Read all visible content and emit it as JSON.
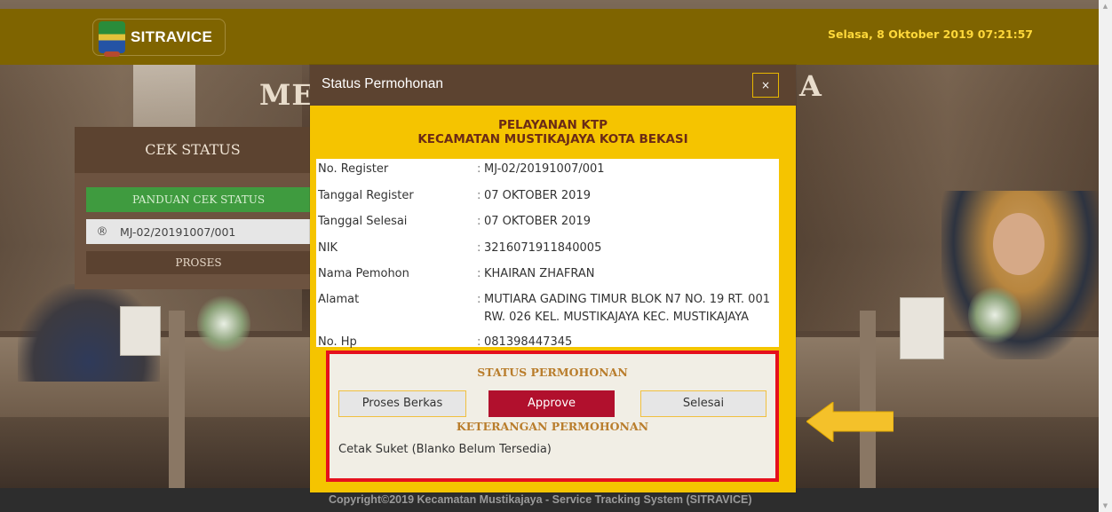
{
  "header": {
    "logo_text": "SITRAVICE",
    "datetime": "Selasa, 8 Oktober 2019 07:21:57"
  },
  "background": {
    "wall_text_left": "ME",
    "wall_text_right": "A"
  },
  "cek_status": {
    "title": "CEK STATUS",
    "panduan_label": "PANDUAN CEK STATUS",
    "input_icon": "registered-icon",
    "input_value": "MJ-02/20191007/001",
    "proses_label": "PROSES"
  },
  "modal": {
    "title": "Status Permohonan",
    "close_symbol": "×",
    "service_line1": "PELAYANAN KTP",
    "service_line2": "KECAMATAN MUSTIKAJAYA KOTA BEKASI",
    "fields": [
      {
        "label": "No. Register",
        "value": "MJ-02/20191007/001"
      },
      {
        "label": "Tanggal Register",
        "value": "07 OKTOBER 2019"
      },
      {
        "label": "Tanggal Selesai",
        "value": "07 OKTOBER 2019"
      },
      {
        "label": "NIK",
        "value": "3216071911840005"
      },
      {
        "label": "Nama Pemohon",
        "value": "KHAIRAN ZHAFRAN"
      },
      {
        "label": "Alamat",
        "value": "MUTIARA GADING TIMUR BLOK N7 NO. 19 RT. 001 RW. 026 KEL. MUSTIKAJAYA KEC. MUSTIKAJAYA"
      },
      {
        "label": "No. Hp",
        "value": "081398447345"
      }
    ],
    "status_heading": "STATUS PERMOHONAN",
    "status_buttons": [
      "Proses Berkas",
      "Approve",
      "Selesai"
    ],
    "active_status": "Approve",
    "keterangan_heading": "KETERANGAN PERMOHONAN",
    "keterangan_text": "Cetak Suket (Blanko Belum Tersedia)"
  },
  "footer": {
    "text": "Copyright©2019 Kecamatan Mustikajaya - Service Tracking System (SITRAVICE)"
  },
  "colors": {
    "header_bg": "#7f6400",
    "modal_bg": "#f5c400",
    "modal_header_bg": "#5c4330",
    "active_button": "#b1102d",
    "highlight_border": "#e5101d",
    "arrow": "#f4c12a"
  }
}
